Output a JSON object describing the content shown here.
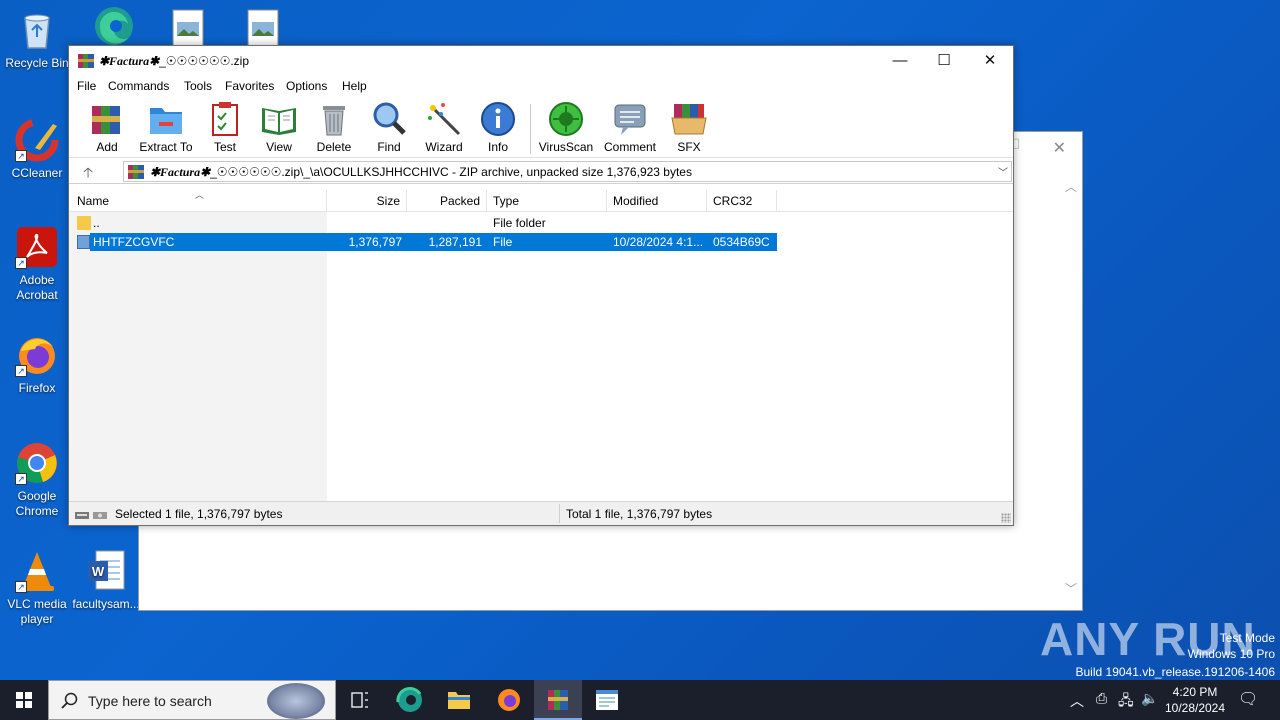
{
  "desktop": {
    "icons": [
      {
        "label": "Recycle Bin"
      },
      {
        "label": "CCleaner"
      },
      {
        "label": "Adobe Acrobat"
      },
      {
        "label": "Firefox"
      },
      {
        "label": "Google Chrome"
      },
      {
        "label": "VLC media player"
      },
      {
        "label": "facultysam..."
      }
    ]
  },
  "window": {
    "title_prefix": "✱Factura✱",
    "title_suffix": "_☉☉☉☉☉☉.zip",
    "menu": [
      "File",
      "Commands",
      "Tools",
      "Favorites",
      "Options",
      "Help"
    ],
    "toolbar": [
      {
        "label": "Add",
        "icon": "add-archive-icon"
      },
      {
        "label": "Extract To",
        "icon": "extract-folder-icon"
      },
      {
        "label": "Test",
        "icon": "test-clipboard-icon"
      },
      {
        "label": "View",
        "icon": "view-book-icon"
      },
      {
        "label": "Delete",
        "icon": "trash-icon"
      },
      {
        "label": "Find",
        "icon": "magnifier-icon"
      },
      {
        "label": "Wizard",
        "icon": "wizard-wand-icon"
      },
      {
        "label": "Info",
        "icon": "info-icon"
      },
      {
        "label": "VirusScan",
        "icon": "virus-scan-icon"
      },
      {
        "label": "Comment",
        "icon": "comment-icon"
      },
      {
        "label": "SFX",
        "icon": "sfx-box-icon"
      }
    ],
    "path_prefix": "✱Factura✱",
    "path_text": "_☉☉☉☉☉☉.zip\\_\\a\\OCULLKSJHHCCHIVC - ZIP archive, unpacked size 1,376,923 bytes",
    "columns": [
      "Name",
      "Size",
      "Packed",
      "Type",
      "Modified",
      "CRC32"
    ],
    "rows": [
      {
        "name": "..",
        "size": "",
        "packed": "",
        "type": "File folder",
        "modified": "",
        "crc": ""
      },
      {
        "name": "HHTFZCGVFC",
        "size": "1,376,797",
        "packed": "1,287,191",
        "type": "File",
        "modified": "10/28/2024 4:1...",
        "crc": "0534B69C"
      }
    ],
    "status_selected": "Selected 1 file, 1,376,797 bytes",
    "status_total": "Total 1 file, 1,376,797 bytes"
  },
  "watermark": {
    "text": "ANY RUN",
    "mode": "Test Mode",
    "edition": "Windows 10 Pro",
    "build": "Build 19041.vb_release.191206-1406"
  },
  "taskbar": {
    "search_placeholder": "Type here to search",
    "time": "4:20 PM",
    "date": "10/28/2024"
  },
  "colors": {
    "selection": "#0078d7",
    "desktop": "#0b64cf",
    "taskbar": "#1a1f2b"
  }
}
